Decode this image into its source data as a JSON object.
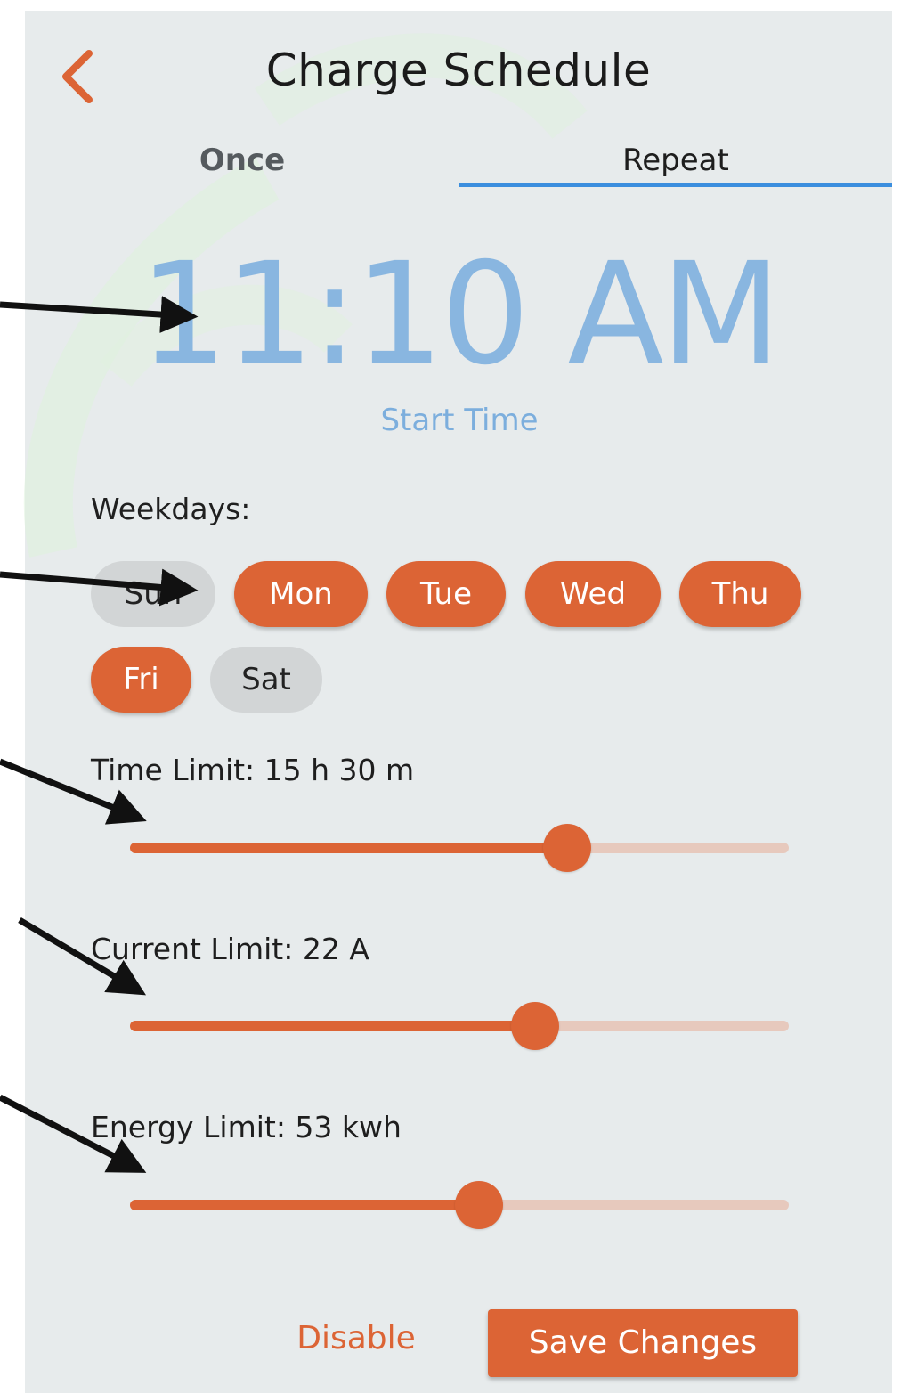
{
  "header": {
    "title": "Charge Schedule",
    "back_icon": "chevron-left-icon"
  },
  "tabs": [
    {
      "label": "Once",
      "selected": false
    },
    {
      "label": "Repeat",
      "selected": true
    }
  ],
  "start_time": {
    "value": "11:10 AM",
    "label": "Start Time"
  },
  "weekdays": {
    "label": "Weekdays:",
    "days": [
      {
        "label": "Sun",
        "selected": false
      },
      {
        "label": "Mon",
        "selected": true
      },
      {
        "label": "Tue",
        "selected": true
      },
      {
        "label": "Wed",
        "selected": true
      },
      {
        "label": "Thu",
        "selected": true
      },
      {
        "label": "Fri",
        "selected": true
      },
      {
        "label": "Sat",
        "selected": false
      }
    ]
  },
  "limits": {
    "time": {
      "label": "Time Limit: 15 h 30 m",
      "slider_fraction": 0.664
    },
    "current": {
      "label": "Current Limit: 22 A",
      "slider_fraction": 0.615
    },
    "energy": {
      "label": "Energy Limit: 53 kwh",
      "slider_fraction": 0.53
    }
  },
  "actions": {
    "disable_label": "Disable",
    "save_label": "Save Changes"
  },
  "colors": {
    "accent": "#dc6435",
    "accent_track": "#e7c9bd",
    "time_blue": "#89b6e0",
    "tab_indicator": "#3b8ede",
    "chip_off": "#d2d5d6",
    "background": "#e7ebec"
  }
}
